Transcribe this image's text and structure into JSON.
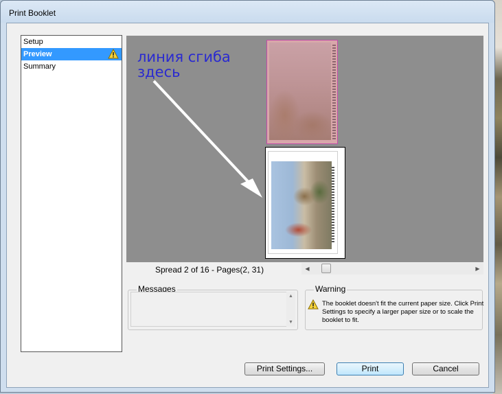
{
  "window": {
    "title": "Print Booklet"
  },
  "nav": {
    "items": [
      {
        "label": "Setup",
        "selected": false
      },
      {
        "label": "Preview",
        "selected": true,
        "icon": "warning-triangle-icon"
      },
      {
        "label": "Summary",
        "selected": false
      }
    ]
  },
  "preview": {
    "annotation_line1": "линия сгиба",
    "annotation_line2": "здесь",
    "annotation_color": "#2a2ad0",
    "spread_label": "Spread 2 of 16 - Pages(2, 31)"
  },
  "messages": {
    "label": "Messages"
  },
  "warning": {
    "label": "Warning",
    "text": "The booklet doesn't fit the current paper size. Click Print Settings to specify a larger paper size or to scale the booklet to fit.",
    "icon": "warning-triangle-icon"
  },
  "buttons": {
    "print_settings": "Print Settings...",
    "print": "Print",
    "cancel": "Cancel"
  },
  "colors": {
    "selection": "#3399ff",
    "preview_bg": "#8e8e8e",
    "page_highlight": "#c04ca8"
  }
}
